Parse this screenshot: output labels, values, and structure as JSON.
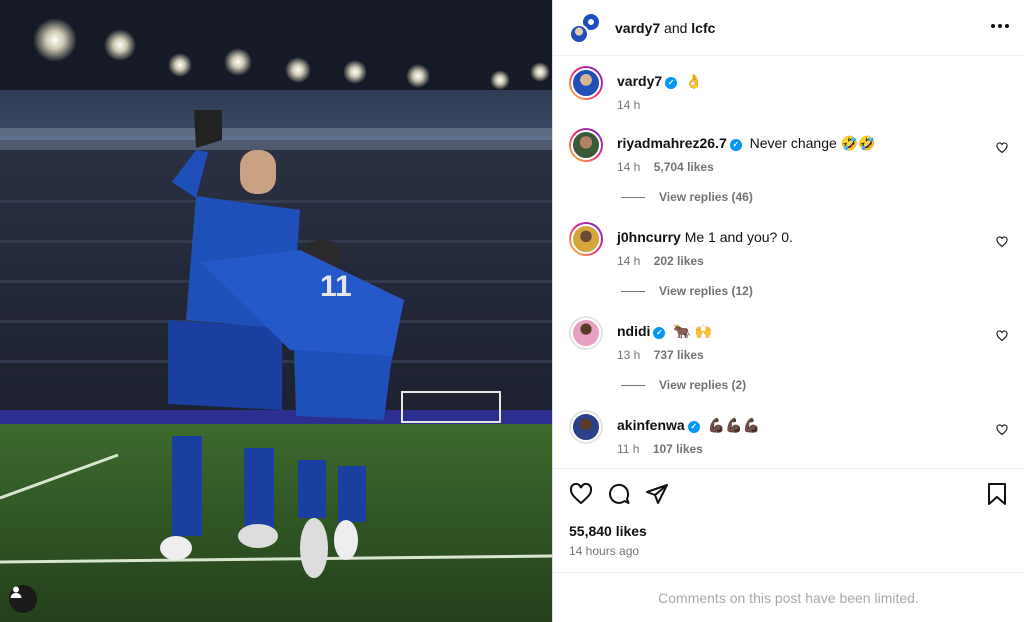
{
  "post_header": {
    "user1": "vardy7",
    "joiner": "and",
    "user2": "lcfc"
  },
  "caption": {
    "username": "vardy7",
    "text": "👌",
    "time": "14 h"
  },
  "comments": [
    {
      "username": "riyadmahrez26.7",
      "verified": true,
      "text": "Never change 🤣🤣",
      "time": "14 h",
      "likes": "5,704 likes",
      "replies": "View replies (46)",
      "avatar_color": "#3a5a3a"
    },
    {
      "username": "j0hncurry",
      "verified": false,
      "text": "Me 1 and you? 0.",
      "time": "14 h",
      "likes": "202 likes",
      "replies": "View replies (12)",
      "avatar_color": "#d4a53a"
    },
    {
      "username": "ndidi",
      "verified": true,
      "text": "🐂 🙌",
      "time": "13 h",
      "likes": "737 likes",
      "replies": "View replies (2)",
      "avatar_color": "#e7a0c0"
    },
    {
      "username": "akinfenwa",
      "verified": true,
      "text": "💪🏿💪🏿💪🏿",
      "time": "11 h",
      "likes": "107 likes",
      "replies": "",
      "avatar_color": "#2b3f8a"
    }
  ],
  "engagement": {
    "likes": "55,840 likes",
    "posted": "14 hours ago"
  },
  "footer": {
    "limited_text": "Comments on this post have been limited."
  },
  "icons": {
    "like": "heart-icon",
    "comment": "comment-icon",
    "share": "share-icon",
    "save": "bookmark-icon",
    "more": "more-icon",
    "tags": "user-tag-icon"
  },
  "colors": {
    "verified": "#0095f6",
    "secondary_text": "#737373",
    "kit_blue": "#1f4fb8"
  }
}
